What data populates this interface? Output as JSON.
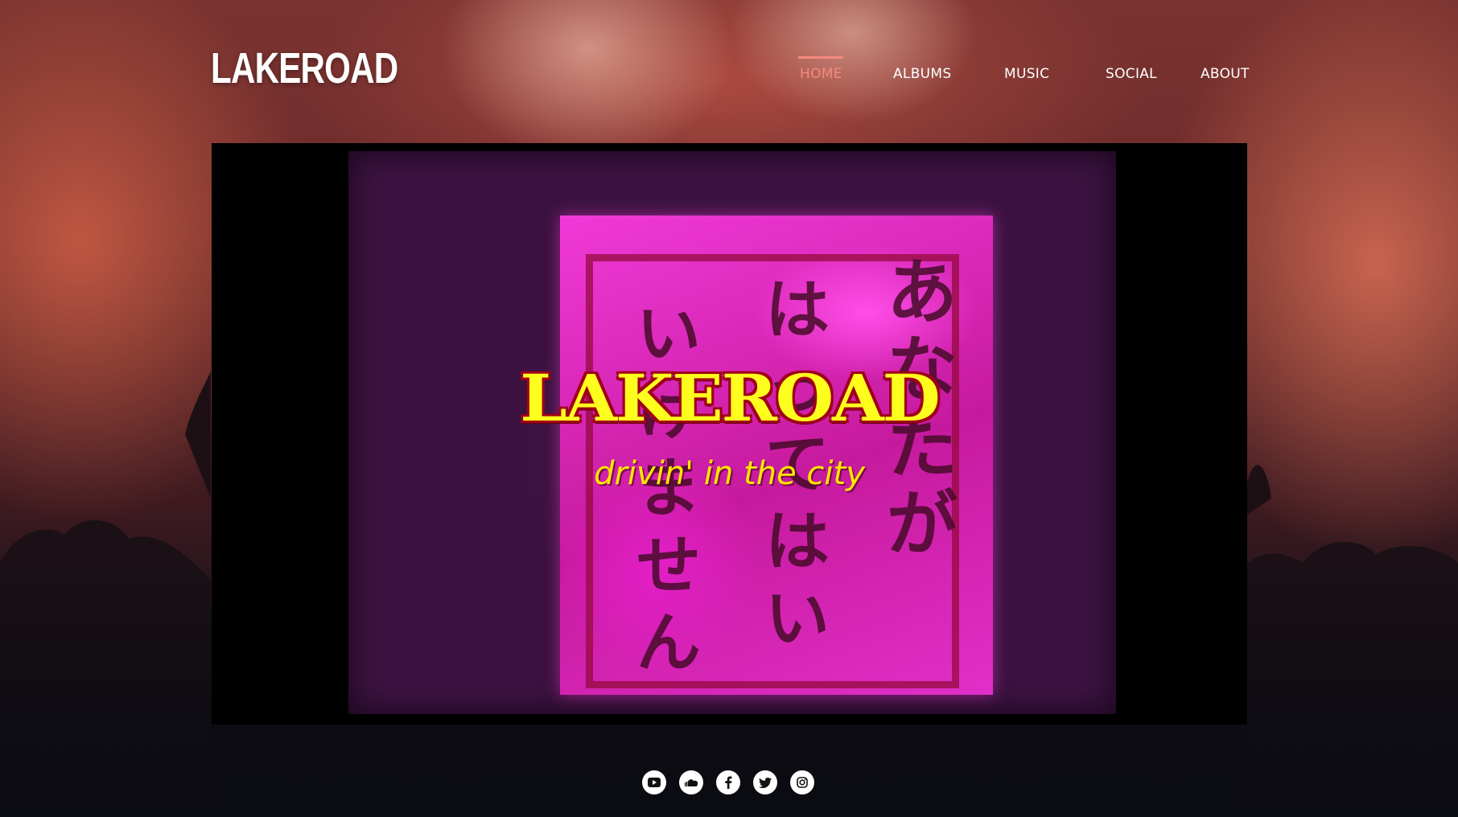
{
  "site": {
    "logo": "LAKEROAD"
  },
  "nav": {
    "items": [
      {
        "label": "HOME",
        "active": true
      },
      {
        "label": "ALBUMS",
        "active": false
      },
      {
        "label": "MUSIC",
        "active": false
      },
      {
        "label": "SOCIAL",
        "active": false
      },
      {
        "label": "ABOUT",
        "active": false
      }
    ],
    "active_color": "#f4897d"
  },
  "video": {
    "title": "LAKEROAD",
    "subtitle": "drivin' in the city",
    "sign_text": {
      "column_1": "あなたが",
      "column_2": "はってはい",
      "column_3": "いけません"
    },
    "title_color": "#ffff1e"
  },
  "social": {
    "icons": [
      "youtube-icon",
      "soundcloud-icon",
      "facebook-icon",
      "twitter-icon",
      "instagram-icon"
    ]
  }
}
